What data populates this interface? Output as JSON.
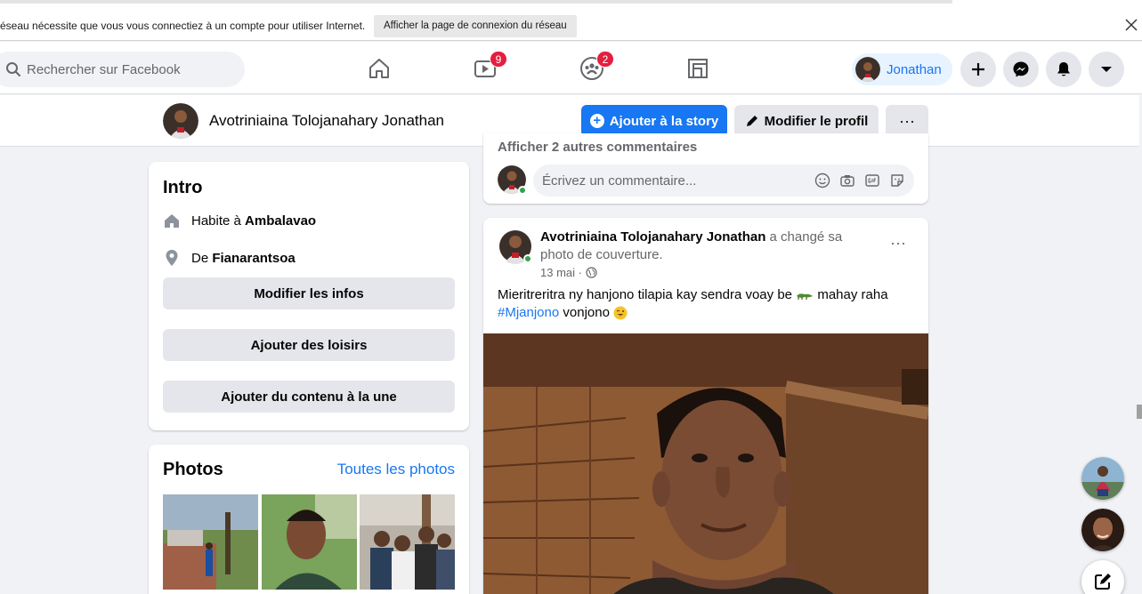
{
  "network_bar": {
    "message": "éseau nécessite que vous vous connectiez à un compte pour utiliser Internet.",
    "button": "Afficher la page de connexion du réseau",
    "close_icon": "close-icon"
  },
  "topbar": {
    "search_placeholder": "Rechercher sur Facebook",
    "nav": [
      {
        "name": "home",
        "icon": "home-icon",
        "badge": ""
      },
      {
        "name": "watch",
        "icon": "video-icon",
        "badge": "9"
      },
      {
        "name": "groups",
        "icon": "groups-icon",
        "badge": "2"
      },
      {
        "name": "gaming",
        "icon": "gaming-icon",
        "badge": ""
      }
    ],
    "profile_label": "Jonathan",
    "actions": [
      "plus-icon",
      "messenger-icon",
      "bell-icon",
      "caret-down-icon"
    ]
  },
  "profile_header": {
    "name": "Avotriniaina Tolojanahary Jonathan",
    "add_story": "Ajouter à la story",
    "edit_profile": "Modifier le profil",
    "more": "···"
  },
  "intro": {
    "title": "Intro",
    "lives_prefix": "Habite à ",
    "lives_place": "Ambalavao",
    "from_prefix": "De ",
    "from_place": "Fianarantsoa",
    "buttons": [
      "Modifier les infos",
      "Ajouter des loisirs",
      "Ajouter du contenu à la une"
    ]
  },
  "photos": {
    "title": "Photos",
    "link": "Toutes les photos"
  },
  "comments": {
    "more_comments": "Afficher 2 autres commentaires",
    "placeholder": "Écrivez un commentaire..."
  },
  "post": {
    "author": "Avotriniaina Tolojanahary Jonathan",
    "action": " a changé sa photo de couverture.",
    "date": "13 mai",
    "separator": " · ",
    "text_before_emoji": "Mieritreritra ny hanjono tilapia kay sendra voay be ",
    "text_after_emoji": " mahay raha",
    "hashtag": "#Mjanjono",
    "text_end": " vonjono ",
    "dots": "···"
  },
  "colors": {
    "accent": "#1877f2",
    "badge": "#e41e3f",
    "online": "#31a24c",
    "page_bg": "#f0f2f5"
  }
}
